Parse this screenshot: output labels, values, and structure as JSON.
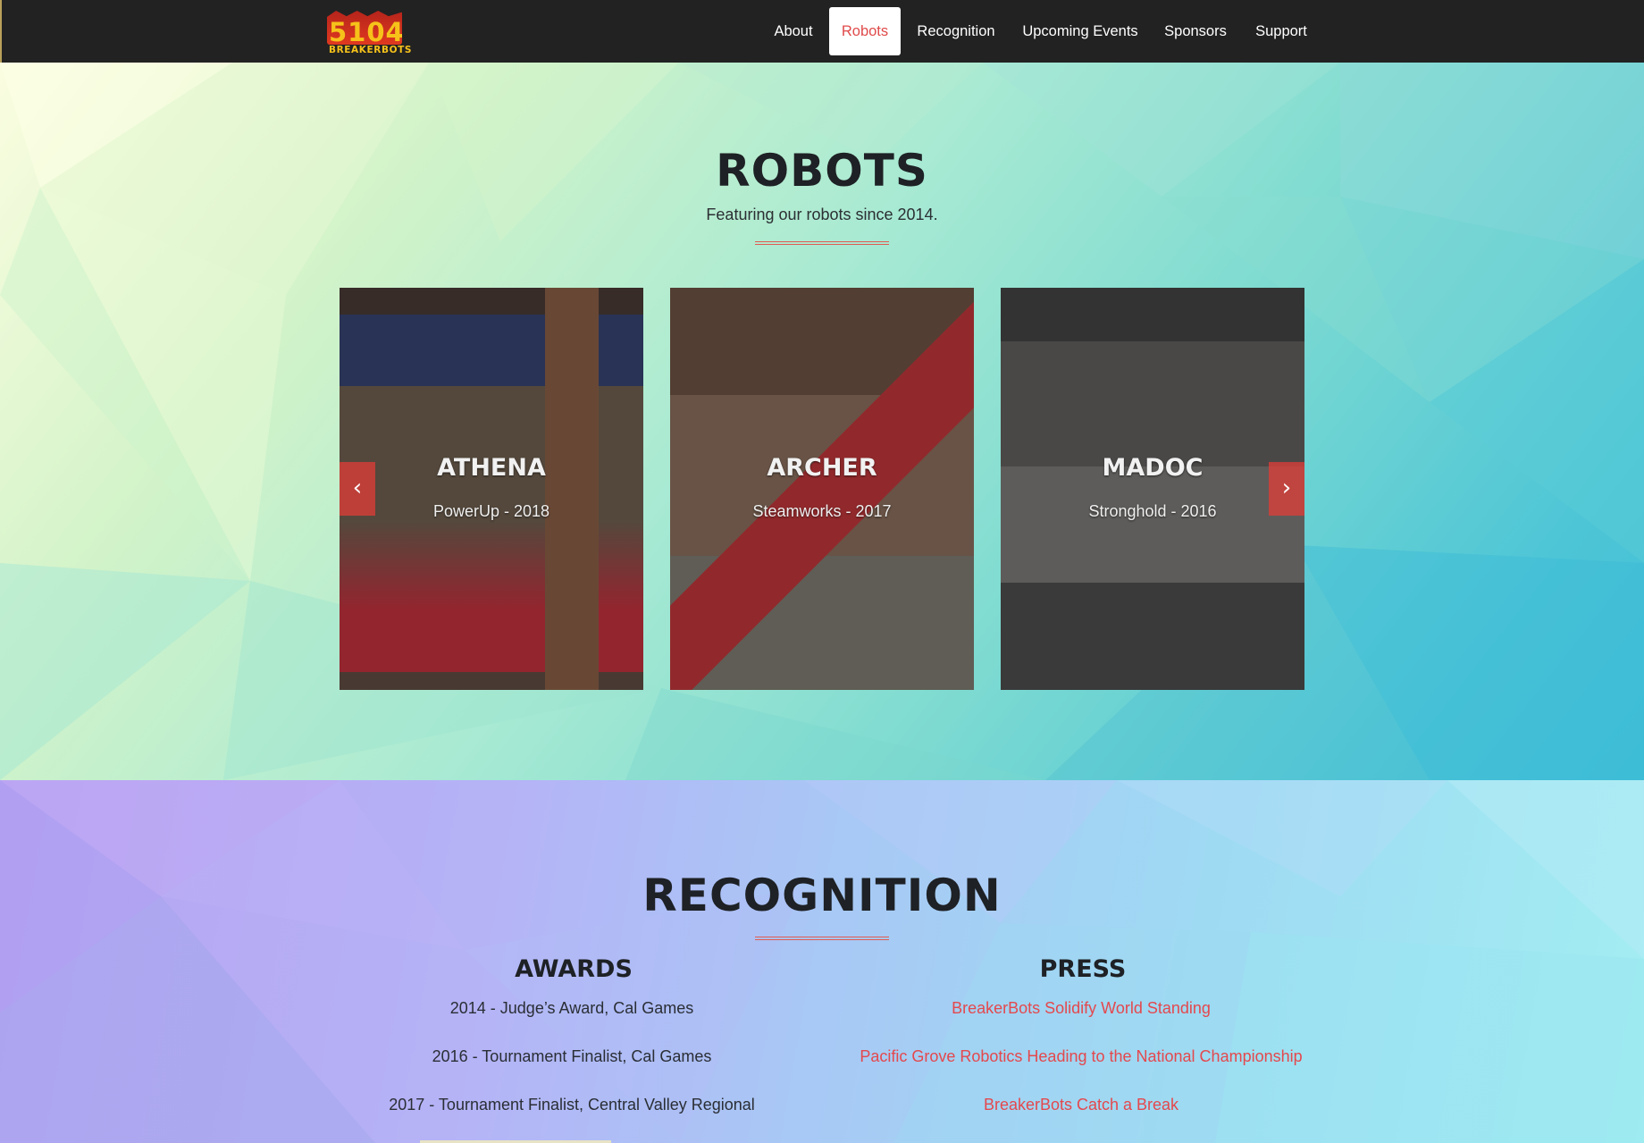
{
  "brand": {
    "number": "5104",
    "name": "BREAKERBOTS"
  },
  "nav": {
    "items": [
      {
        "label": "About"
      },
      {
        "label": "Robots",
        "active": true
      },
      {
        "label": "Recognition"
      },
      {
        "label": "Upcoming Events"
      },
      {
        "label": "Sponsors"
      },
      {
        "label": "Support"
      }
    ]
  },
  "robots": {
    "title": "ROBOTS",
    "subtitle": "Featuring our robots since 2014.",
    "cards": [
      {
        "name": "ATHENA",
        "season": "PowerUp - 2018"
      },
      {
        "name": "ARCHER",
        "season": "Steamworks - 2017"
      },
      {
        "name": "MADOC",
        "season": "Stronghold - 2016"
      }
    ],
    "prev_icon": "chevron-left-icon",
    "next_icon": "chevron-right-icon"
  },
  "recognition": {
    "title": "RECOGNITION",
    "awards": {
      "title": "AWARDS",
      "items": [
        "2014 - Judge’s Award, Cal Games",
        "2016 - Tournament Finalist, Cal Games",
        "2017 - Tournament Finalist, Central Valley Regional"
      ]
    },
    "press": {
      "title": "PRESS",
      "items": [
        "BreakerBots Solidify World Standing",
        "Pacific Grove Robotics Heading to the National Championship",
        "BreakerBots Catch a Break"
      ]
    }
  },
  "colors": {
    "nav_bg": "#222222",
    "accent": "#e04a4a",
    "heading": "#1e2125"
  }
}
